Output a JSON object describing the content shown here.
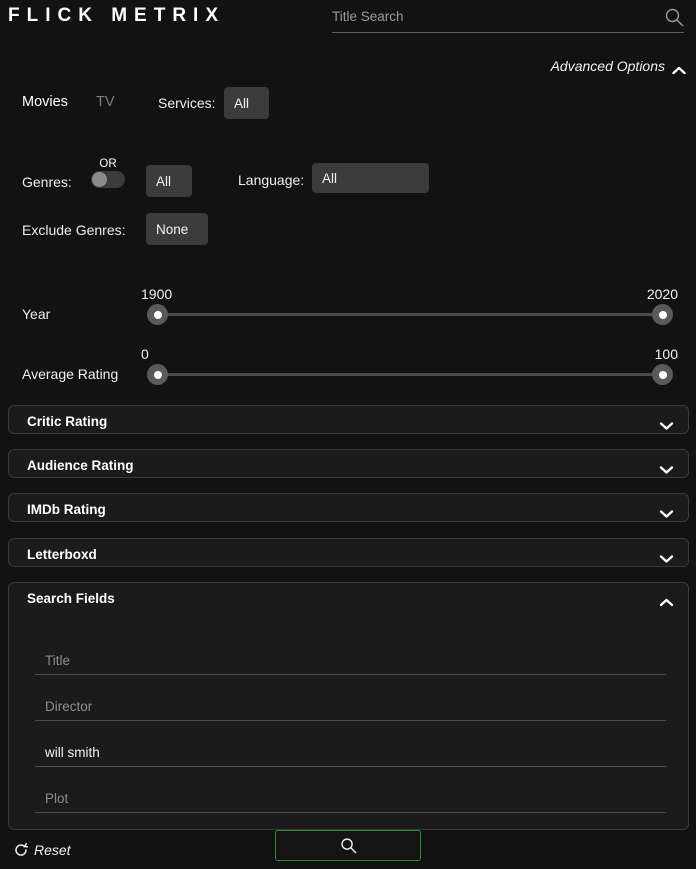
{
  "brand": {
    "logo": "FLICK METRIX"
  },
  "top_search": {
    "value": "",
    "placeholder": "Title Search",
    "icon": "search-icon"
  },
  "advanced_options": {
    "label": "Advanced Options",
    "icon": "chevron-up-icon",
    "expanded": true
  },
  "type_tabs": [
    {
      "label": "Movies",
      "active": true
    },
    {
      "label": "TV",
      "active": false
    }
  ],
  "services": {
    "label": "Services:",
    "value": "All"
  },
  "genres": {
    "label": "Genres:",
    "toggle_label": "OR",
    "toggle_on": false,
    "value": "All"
  },
  "language": {
    "label": "Language:",
    "value": "All"
  },
  "exclude_genres": {
    "label": "Exclude Genres:",
    "value": "None"
  },
  "sliders": [
    {
      "label": "Year",
      "min": "1900",
      "max": "2020"
    },
    {
      "label": "Average Rating",
      "min": "0",
      "max": "100"
    }
  ],
  "accordions": [
    {
      "title": "Critic Rating",
      "icon": "chevron-down-icon",
      "expanded": false
    },
    {
      "title": "Audience Rating",
      "icon": "chevron-down-icon",
      "expanded": false
    },
    {
      "title": "IMDb Rating",
      "icon": "chevron-down-icon",
      "expanded": false
    },
    {
      "title": "Letterboxd",
      "icon": "chevron-down-icon",
      "expanded": false
    },
    {
      "title": "Search Fields",
      "icon": "chevron-up-icon",
      "expanded": true
    }
  ],
  "search_fields": [
    {
      "placeholder": "Title",
      "value": ""
    },
    {
      "placeholder": "Director",
      "value": ""
    },
    {
      "placeholder": "",
      "value": "will smith"
    },
    {
      "placeholder": "Plot",
      "value": ""
    }
  ],
  "footer": {
    "reset_label": "Reset",
    "reset_icon": "refresh-icon",
    "search_icon": "search-icon"
  },
  "colors": {
    "page_bg": "#121212",
    "panel_bg": "#1b1b1b",
    "panel_border": "#3a3a3a",
    "dropdown_bg": "#3b3b3b",
    "accent_green": "#2e8b3d",
    "text_primary": "#f2f2f2",
    "text_muted": "#8d8d8d"
  }
}
